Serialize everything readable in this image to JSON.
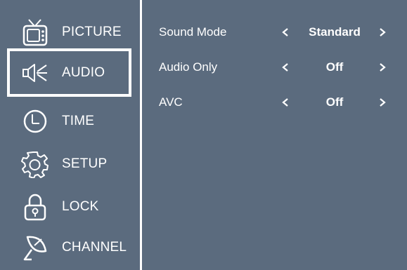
{
  "menu": {
    "items": [
      {
        "label": "PICTURE",
        "icon": "tv-icon"
      },
      {
        "label": "AUDIO",
        "icon": "speaker-icon"
      },
      {
        "label": "TIME",
        "icon": "clock-icon"
      },
      {
        "label": "SETUP",
        "icon": "gear-icon"
      },
      {
        "label": "LOCK",
        "icon": "lock-icon"
      },
      {
        "label": "CHANNEL",
        "icon": "satellite-dish-icon"
      }
    ],
    "selected": "AUDIO"
  },
  "settings": [
    {
      "label": "Sound Mode",
      "value": "Standard"
    },
    {
      "label": "Audio Only",
      "value": "Off"
    },
    {
      "label": "AVC",
      "value": "Off"
    }
  ],
  "colors": {
    "background": "#5b6b7e",
    "text": "#ffffff",
    "highlight_border": "#ffffff"
  }
}
